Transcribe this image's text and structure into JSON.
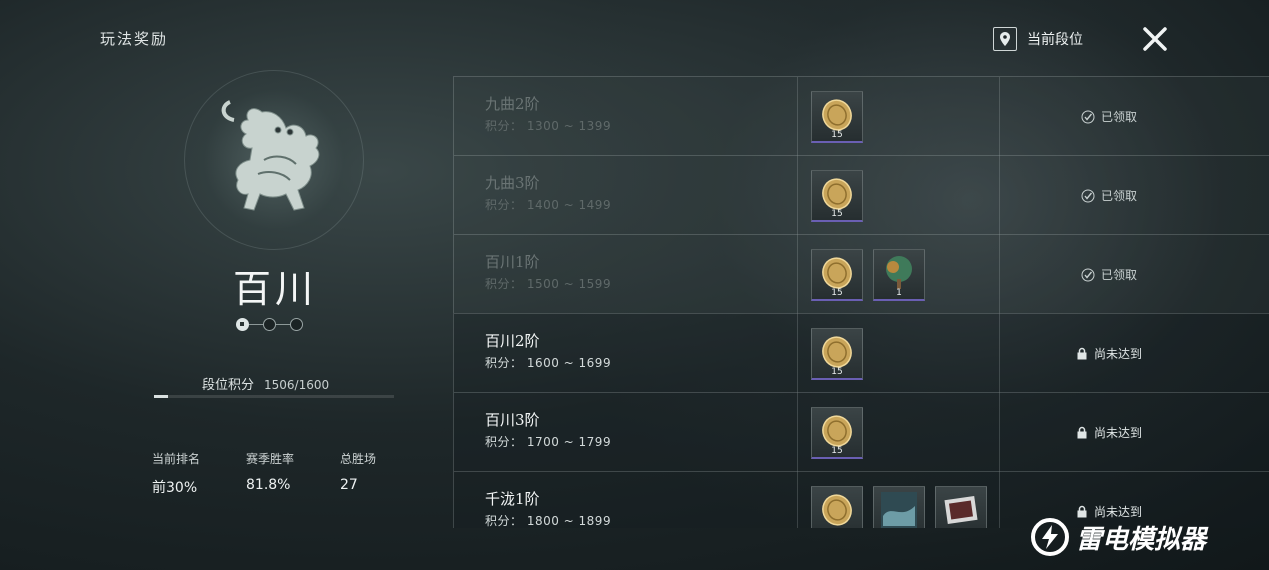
{
  "header": {
    "title": "玩法奖励",
    "current_rank_label": "当前段位"
  },
  "rank": {
    "name": "百川",
    "score_label": "段位积分",
    "score_value": "1506/1600",
    "progress": 0.06
  },
  "stats": [
    {
      "label": "当前排名",
      "value": "前30%"
    },
    {
      "label": "赛季胜率",
      "value": "81.8%"
    },
    {
      "label": "总胜场",
      "value": "27"
    }
  ],
  "tiers": [
    {
      "name": "九曲2阶",
      "range": "积分： 1300 ~ 1399",
      "status": "已领取",
      "claimed": true,
      "rewards": [
        {
          "icon": "coin-icon",
          "count": "15"
        }
      ]
    },
    {
      "name": "九曲3阶",
      "range": "积分： 1400 ~ 1499",
      "status": "已领取",
      "claimed": true,
      "rewards": [
        {
          "icon": "coin-icon",
          "count": "15"
        }
      ]
    },
    {
      "name": "百川1阶",
      "range": "积分： 1500 ~ 1599",
      "status": "已领取",
      "claimed": true,
      "rewards": [
        {
          "icon": "coin-icon",
          "count": "15"
        },
        {
          "icon": "tree-icon",
          "count": "1"
        }
      ]
    },
    {
      "name": "百川2阶",
      "range": "积分： 1600 ~ 1699",
      "status": "尚未达到",
      "claimed": false,
      "rewards": [
        {
          "icon": "coin-icon",
          "count": "15"
        }
      ]
    },
    {
      "name": "百川3阶",
      "range": "积分： 1700 ~ 1799",
      "status": "尚未达到",
      "claimed": false,
      "rewards": [
        {
          "icon": "coin-icon",
          "count": "15"
        }
      ]
    },
    {
      "name": "千泷1阶",
      "range": "积分： 1800 ~ 1899",
      "status": "尚未达到",
      "claimed": false,
      "rewards": [
        {
          "icon": "coin-icon",
          "count": ""
        },
        {
          "icon": "wave-icon",
          "count": ""
        },
        {
          "icon": "frame-icon",
          "count": ""
        }
      ]
    }
  ],
  "watermark": "雷电模拟器"
}
